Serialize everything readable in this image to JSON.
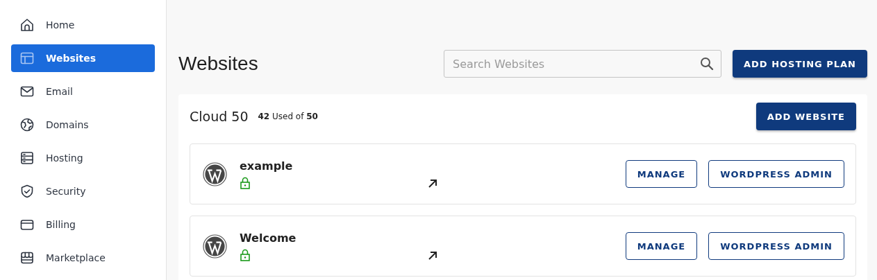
{
  "sidebar": {
    "items": [
      {
        "label": "Home",
        "selected": false
      },
      {
        "label": "Websites",
        "selected": true
      },
      {
        "label": "Email",
        "selected": false
      },
      {
        "label": "Domains",
        "selected": false
      },
      {
        "label": "Hosting",
        "selected": false
      },
      {
        "label": "Security",
        "selected": false
      },
      {
        "label": "Billing",
        "selected": false
      },
      {
        "label": "Marketplace",
        "selected": false
      }
    ]
  },
  "page": {
    "title": "Websites",
    "search": {
      "placeholder": "Search Websites"
    },
    "add_button": "ADD HOSTING PLAN"
  },
  "plan": {
    "name": "Cloud 50",
    "usage": "**42** Used of **50**",
    "add_button": "ADD WEBSITE",
    "sites": [
      {
        "name": "example",
        "buttons": [
          "MANAGE",
          "WORDPRESS ADMIN"
        ]
      },
      {
        "name": "Welcome",
        "buttons": [
          "MANAGE",
          "WORDPRESS ADMIN"
        ]
      }
    ]
  }
}
